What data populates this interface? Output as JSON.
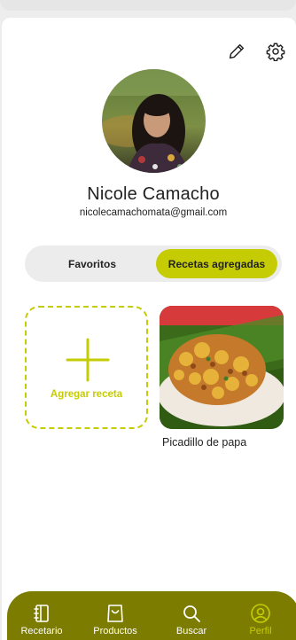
{
  "profile": {
    "name": "Nicole Camacho",
    "email": "nicolecamachomata@gmail.com"
  },
  "tabs": {
    "favorites_label": "Favoritos",
    "added_label": "Recetas agregadas",
    "active": "added"
  },
  "add_card": {
    "label": "Agregar receta"
  },
  "recipes": [
    {
      "title": "Picadillo de papa"
    }
  ],
  "nav": {
    "items": [
      {
        "label": "Recetario",
        "icon": "notebook-icon"
      },
      {
        "label": "Productos",
        "icon": "shopping-bag-icon"
      },
      {
        "label": "Buscar",
        "icon": "search-icon"
      },
      {
        "label": "Perfil",
        "icon": "user-circle-icon"
      }
    ],
    "active": "Perfil"
  },
  "colors": {
    "accent": "#c6cc04",
    "nav_bg": "#7c7c00",
    "text": "#222222"
  }
}
